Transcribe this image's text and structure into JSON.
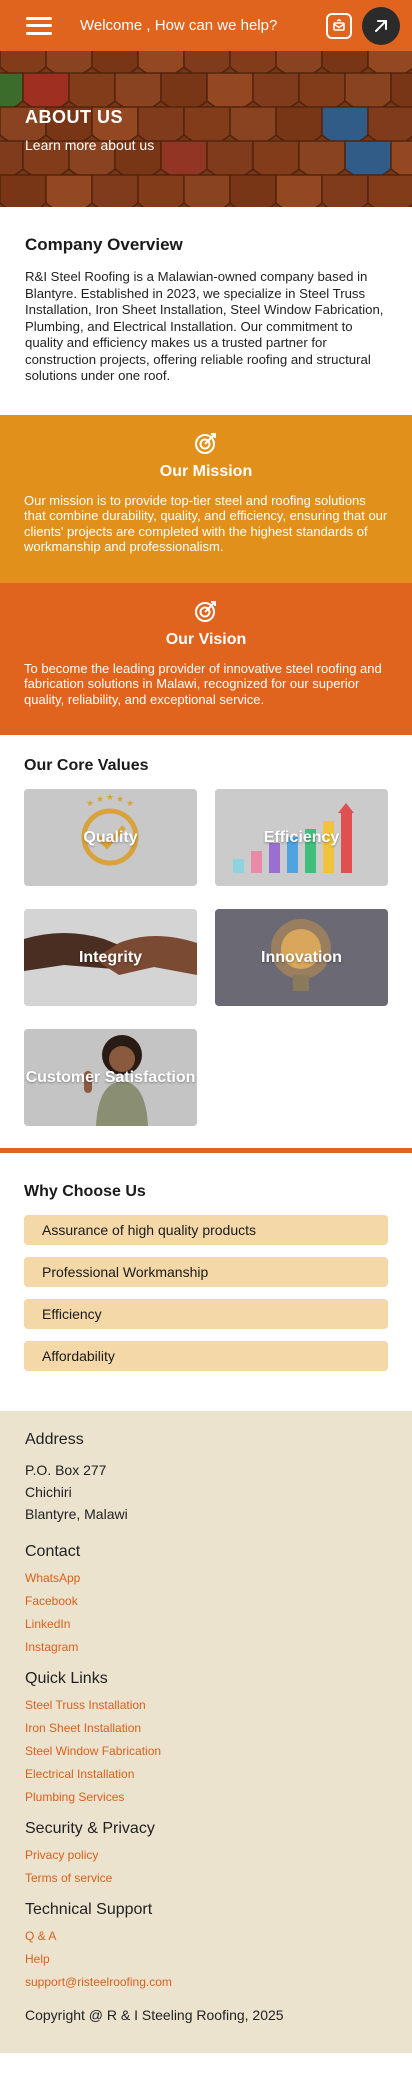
{
  "header": {
    "welcome_text": "Welcome , How can we help?"
  },
  "hero": {
    "title": "ABOUT US",
    "subtitle": "Learn more about us"
  },
  "overview": {
    "title": "Company Overview",
    "text": "R&I Steel Roofing is a Malawian-owned company based in Blantyre. Established in 2023, we specialize in Steel Truss Installation, Iron Sheet Installation, Steel Window Fabrication, Plumbing, and Electrical Installation. Our commitment to quality and efficiency makes us a trusted partner for construction projects, offering reliable roofing and structural solutions under one roof."
  },
  "mission": {
    "title": "Our Mission",
    "text": "Our mission is to provide top-tier steel and roofing solutions that combine durability, quality, and efficiency, ensuring that our clients' projects are completed with the highest standards of workmanship and professionalism."
  },
  "vision": {
    "title": "Our Vision",
    "text": "To become the leading provider of innovative steel roofing and fabrication solutions in Malawi, recognized for our superior quality, reliability, and exceptional service."
  },
  "core_values": {
    "title": "Our Core Values",
    "items": [
      {
        "label": "Quality"
      },
      {
        "label": "Efficiency"
      },
      {
        "label": "Integrity"
      },
      {
        "label": "Innovation"
      },
      {
        "label": "Customer Satisfaction"
      }
    ]
  },
  "why": {
    "title": "Why Choose Us",
    "items": [
      "Assurance of high quality products",
      "Professional Workmanship",
      "Efficiency",
      "Affordability"
    ]
  },
  "footer": {
    "address": {
      "title": "Address",
      "lines": [
        "P.O. Box 277",
        "Chichiri",
        "Blantyre, Malawi"
      ]
    },
    "contact": {
      "title": "Contact",
      "links": [
        "WhatsApp",
        "Facebook",
        "LinkedIn",
        "Instagram"
      ]
    },
    "quick_links": {
      "title": "Quick Links",
      "links": [
        "Steel Truss Installation",
        "Iron Sheet Installation",
        "Steel Window Fabrication",
        "Electrical Installation",
        "Plumbing Services"
      ]
    },
    "security": {
      "title": "Security & Privacy",
      "links": [
        "Privacy policy",
        "Terms of service"
      ]
    },
    "support": {
      "title": "Technical Support",
      "links": [
        "Q & A",
        "Help",
        "support@risteelroofing.com"
      ]
    },
    "copyright": "Copyright @ R & I Steeling Roofing, 2025"
  },
  "icons": {
    "menu": "hamburger-menu-icon",
    "chat": "chat-mail-icon",
    "arrow": "arrow-up-right-icon",
    "target": "target-icon"
  },
  "colors": {
    "primary_orange": "#e0631e",
    "mission_amber": "#e1901c",
    "pill_bg": "#f5d8a8",
    "footer_bg": "#ece3cf",
    "link": "#d9601c"
  }
}
